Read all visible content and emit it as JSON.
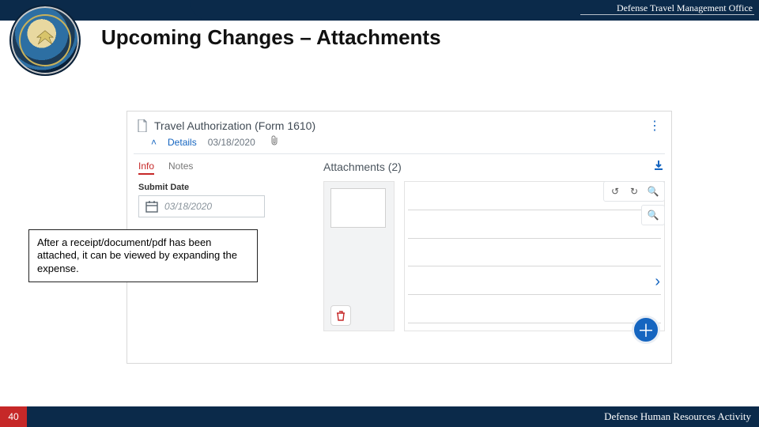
{
  "header": {
    "org": "Defense Travel Management Office",
    "title": "Upcoming Changes – Attachments"
  },
  "callout": "After a receipt/document/pdf has been attached, it can be viewed by expanding the expense.",
  "screenshot": {
    "doc_title": "Travel Authorization (Form 1610)",
    "details_label": "Details",
    "details_date": "03/18/2020",
    "tabs": {
      "info": "Info",
      "notes": "Notes"
    },
    "submit_label": "Submit Date",
    "submit_value": "03/18/2020",
    "attachments_label": "Attachments (2)"
  },
  "footer": {
    "page": "40",
    "org": "Defense Human Resources Activity"
  }
}
